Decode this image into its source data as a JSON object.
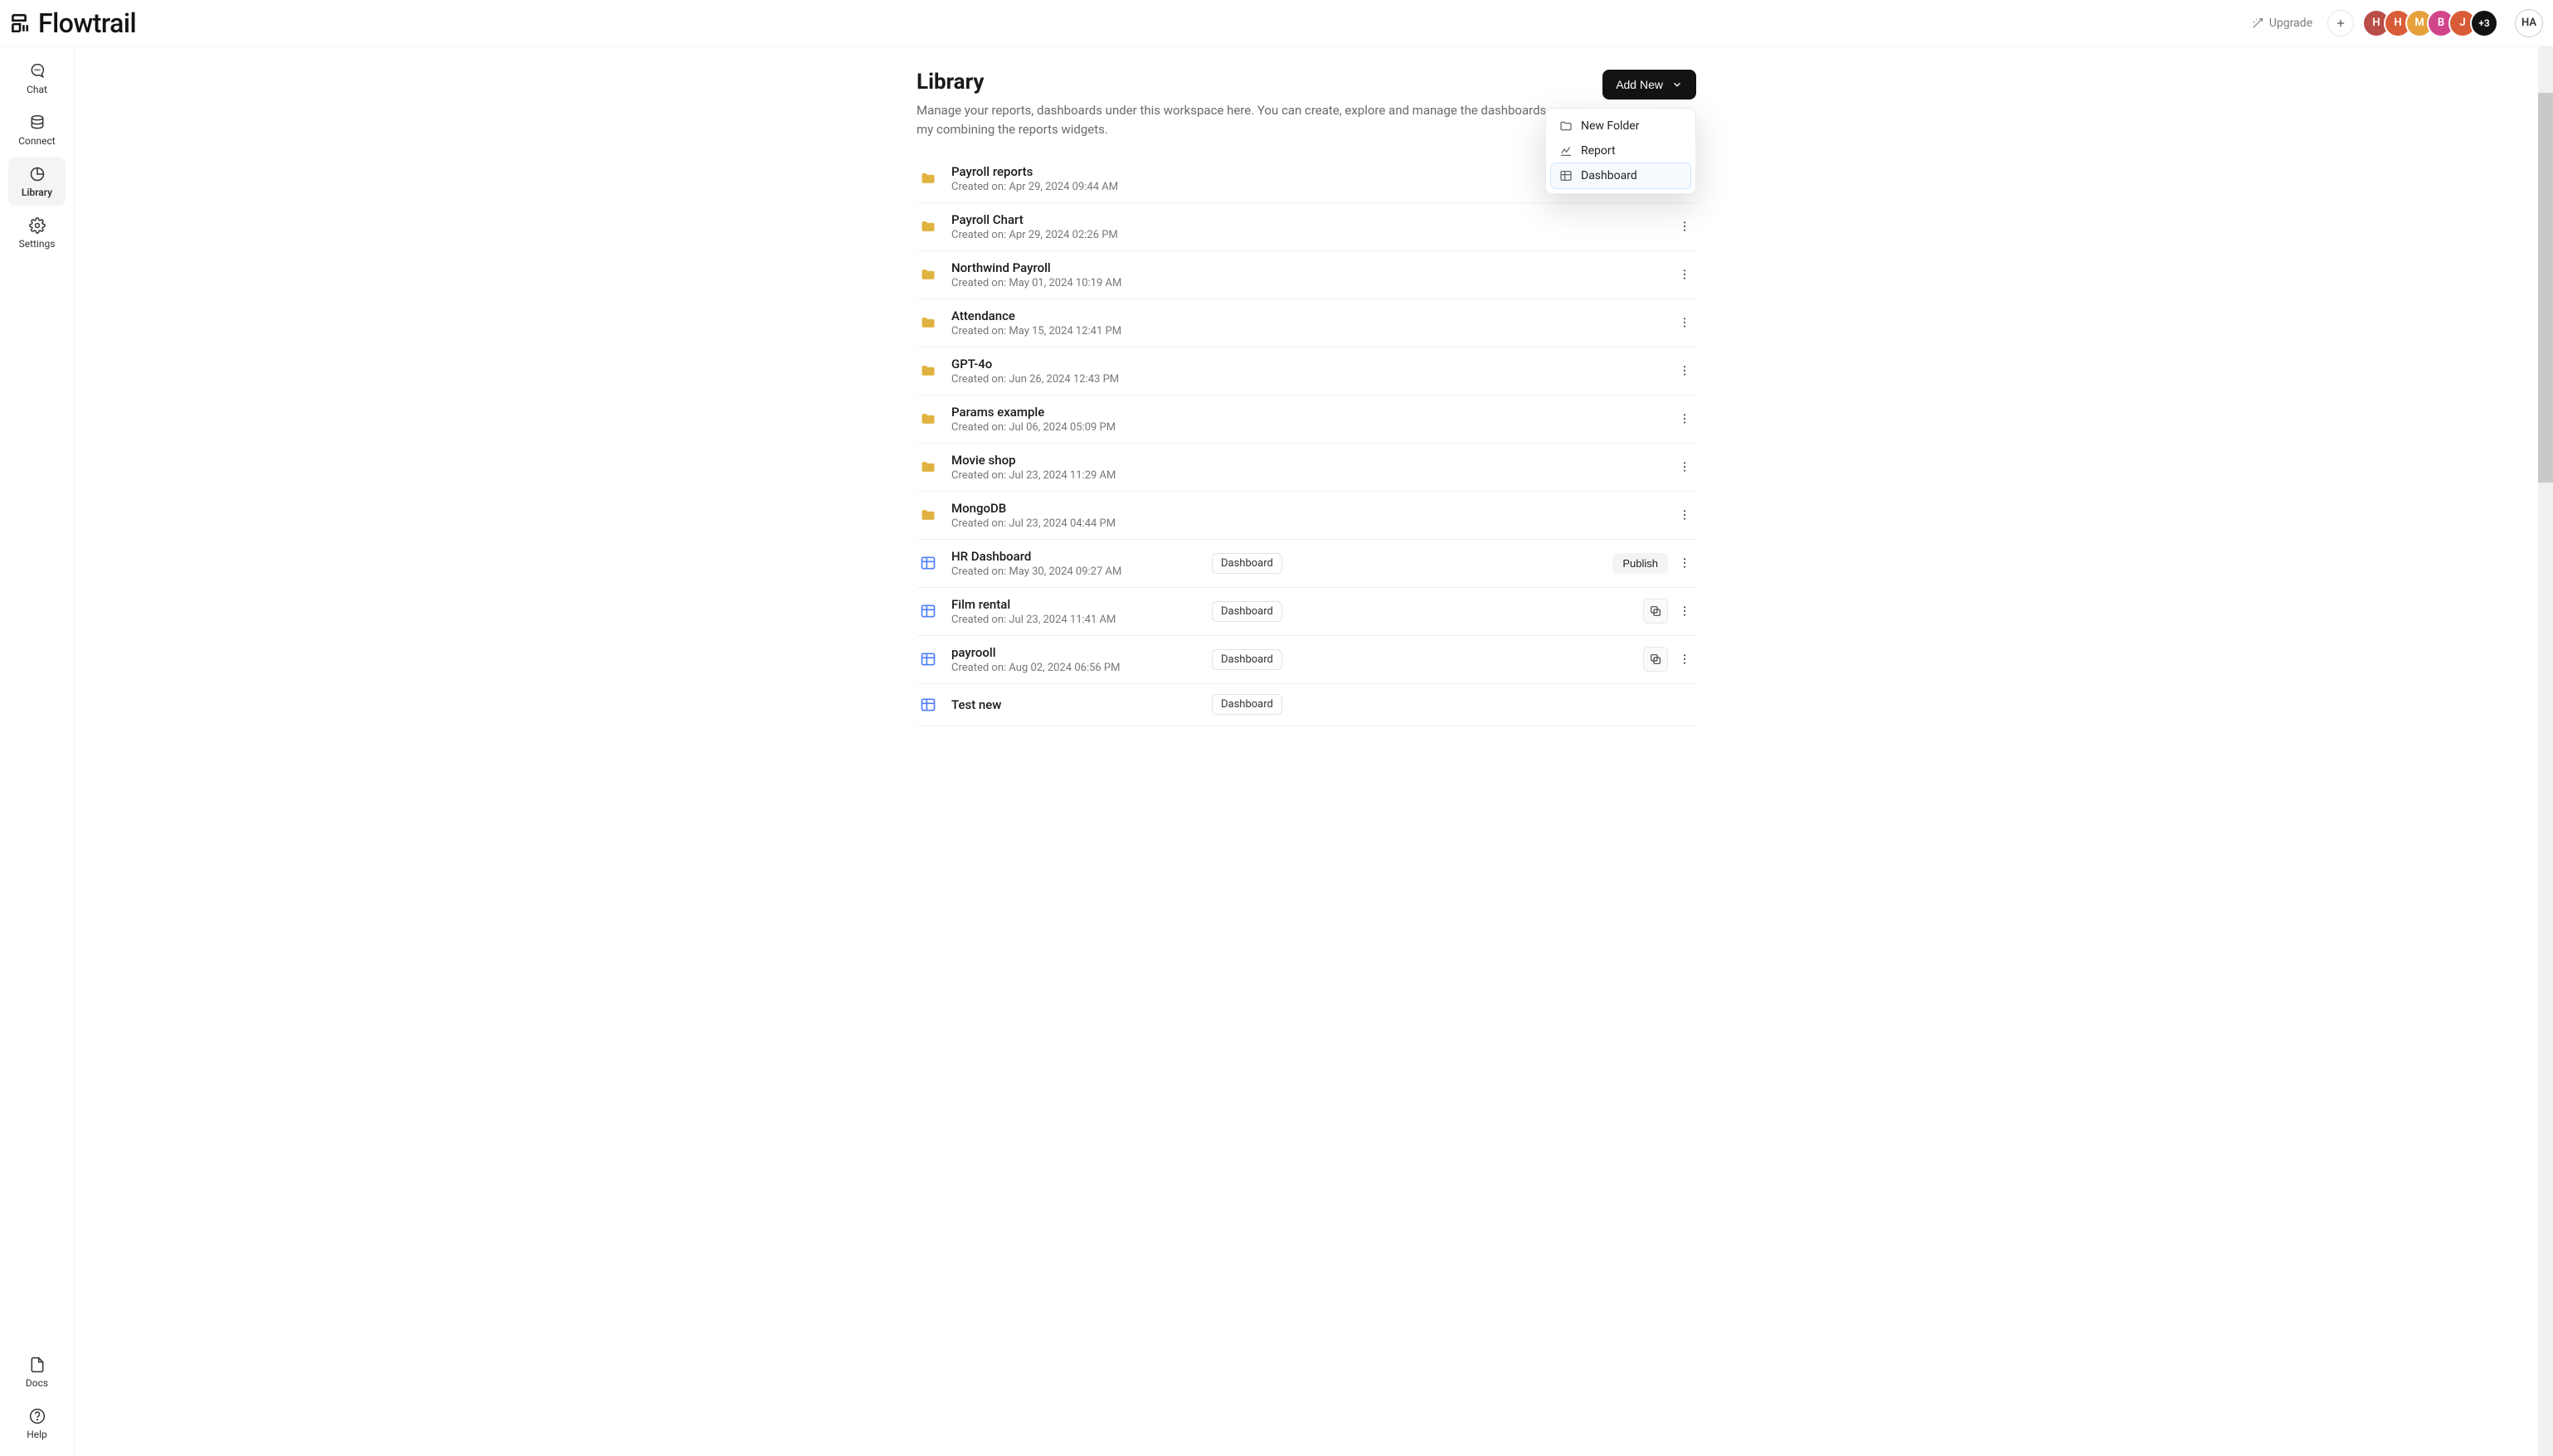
{
  "brand": {
    "name": "Flowtrail"
  },
  "topbar": {
    "upgrade": "Upgrade",
    "avatars": [
      "H",
      "H",
      "M",
      "B",
      "J"
    ],
    "avatar_more": "+3",
    "me": "HA"
  },
  "nav": {
    "chat": "Chat",
    "connect": "Connect",
    "library": "Library",
    "settings": "Settings",
    "docs": "Docs",
    "help": "Help"
  },
  "library": {
    "title": "Library",
    "subtitle": "Manage your reports, dashboards under this workspace here. You can create, explore and manage the dashboards my combining the reports widgets.",
    "add_new": "Add New",
    "dropdown": {
      "new_folder": "New Folder",
      "report": "Report",
      "dashboard": "Dashboard"
    }
  },
  "labels": {
    "created_prefix": "Created on: ",
    "dashboard_tag": "Dashboard",
    "publish": "Publish"
  },
  "items": [
    {
      "kind": "folder",
      "name": "Payroll reports",
      "created": "Apr 29, 2024 09:44 AM",
      "actions": [
        "dots"
      ]
    },
    {
      "kind": "folder",
      "name": "Payroll Chart",
      "created": "Apr 29, 2024 02:26 PM",
      "actions": [
        "dots"
      ]
    },
    {
      "kind": "folder",
      "name": "Northwind Payroll",
      "created": "May 01, 2024 10:19 AM",
      "actions": [
        "dots"
      ]
    },
    {
      "kind": "folder",
      "name": "Attendance",
      "created": "May 15, 2024 12:41 PM",
      "actions": [
        "dots"
      ]
    },
    {
      "kind": "folder",
      "name": "GPT-4o",
      "created": "Jun 26, 2024 12:43 PM",
      "actions": [
        "dots"
      ]
    },
    {
      "kind": "folder",
      "name": "Params example",
      "created": "Jul 06, 2024 05:09 PM",
      "actions": [
        "dots"
      ]
    },
    {
      "kind": "folder",
      "name": "Movie shop",
      "created": "Jul 23, 2024 11:29 AM",
      "actions": [
        "dots"
      ]
    },
    {
      "kind": "folder",
      "name": "MongoDB",
      "created": "Jul 23, 2024 04:44 PM",
      "actions": [
        "dots"
      ]
    },
    {
      "kind": "dashboard",
      "name": "HR Dashboard",
      "created": "May 30, 2024 09:27 AM",
      "actions": [
        "publish",
        "dots"
      ]
    },
    {
      "kind": "dashboard",
      "name": "Film rental",
      "created": "Jul 23, 2024 11:41 AM",
      "actions": [
        "copy",
        "dots"
      ]
    },
    {
      "kind": "dashboard",
      "name": "payrooll",
      "created": "Aug 02, 2024 06:56 PM",
      "actions": [
        "copy",
        "dots"
      ]
    },
    {
      "kind": "dashboard",
      "name": "Test new",
      "created": "",
      "actions": []
    }
  ],
  "colors": {
    "folder": "#e0b340",
    "dashboard_icon": "#4f7eff",
    "accent": "#131313"
  }
}
